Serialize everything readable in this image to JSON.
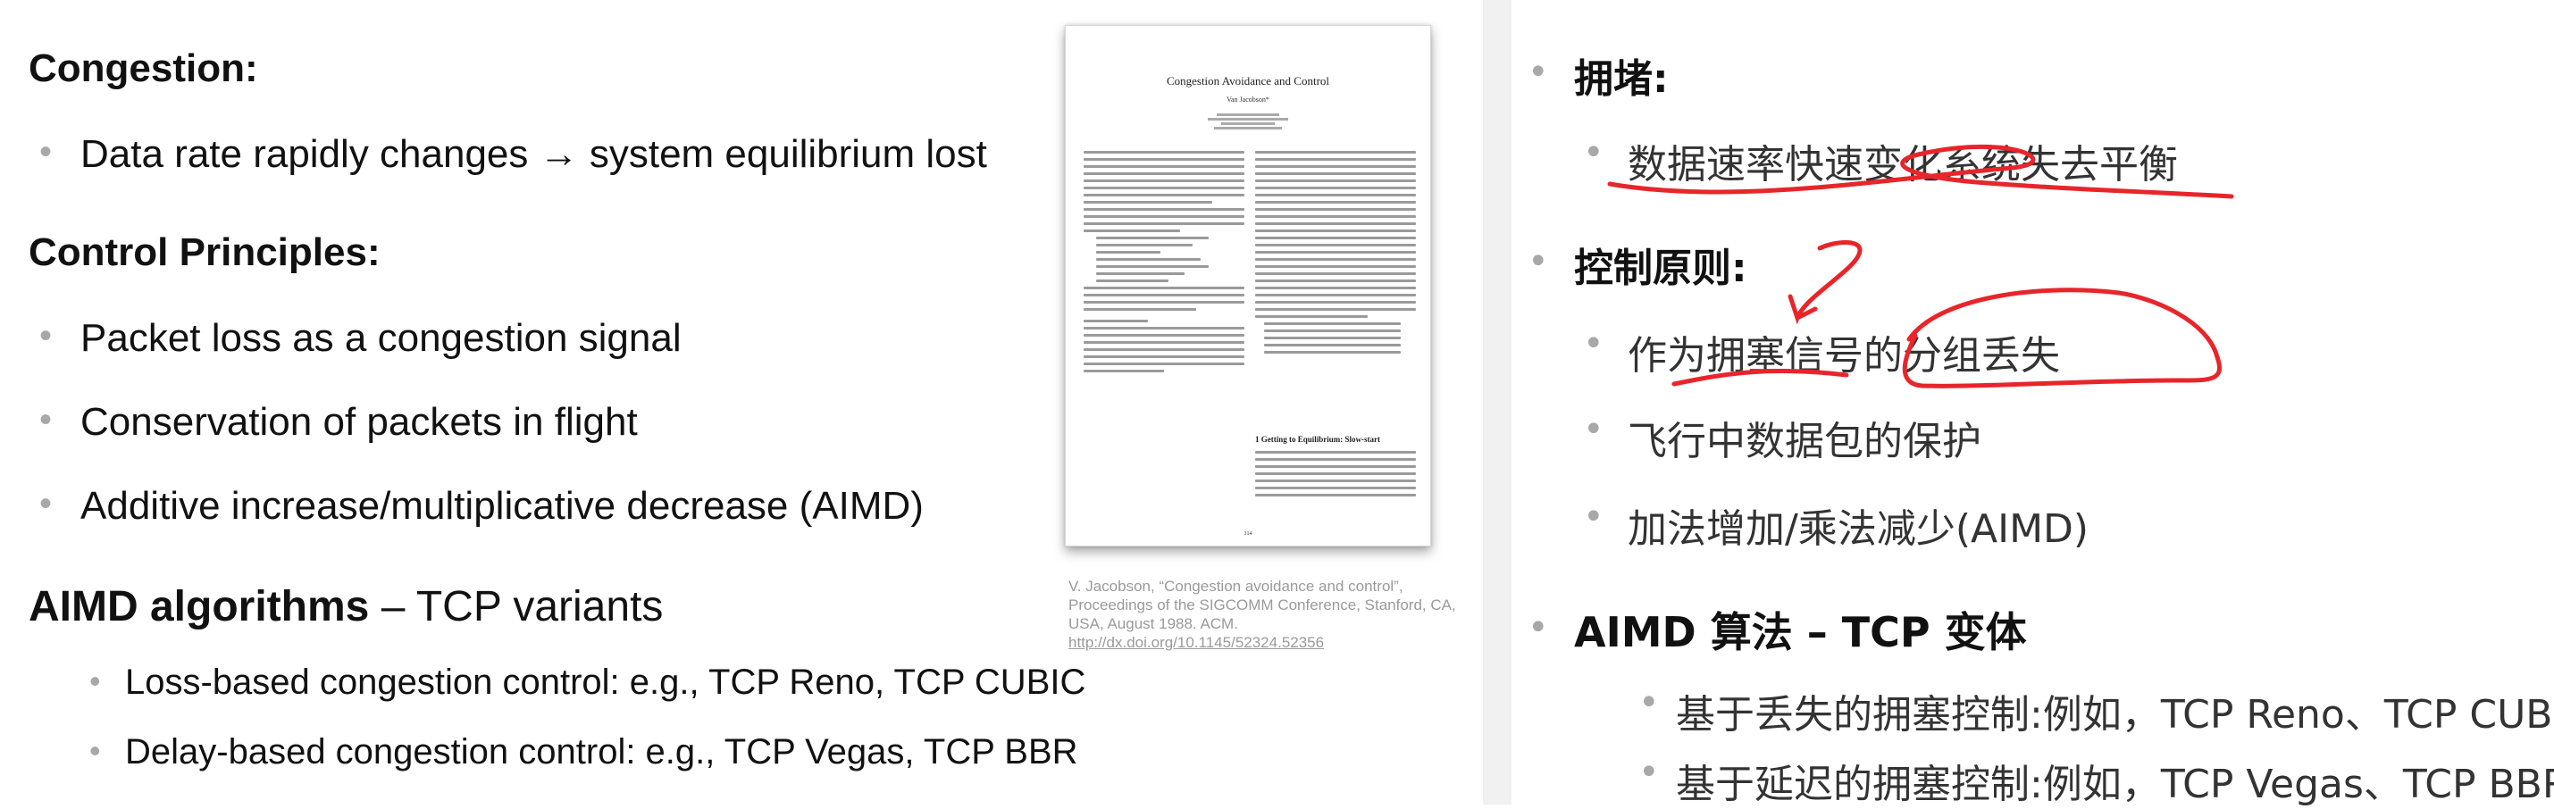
{
  "left": {
    "congestion_heading": "Congestion:",
    "congestion_point": "Data rate rapidly changes → system equilibrium lost",
    "principles_heading": "Control Principles:",
    "principles": [
      "Packet loss as a congestion signal",
      "Conservation of packets in flight",
      "Additive increase/multiplicative decrease (AIMD)"
    ],
    "aimd_heading_bold": "AIMD algorithms",
    "aimd_heading_rest": " – TCP variants",
    "aimd_items": [
      "Loss-based congestion control: e.g., TCP Reno, TCP CUBIC",
      "Delay-based congestion control: e.g., TCP Vegas, TCP BBR"
    ]
  },
  "paper": {
    "title": "Congestion Avoidance and Control",
    "author": "Van Jacobson*",
    "section_heading": "1   Getting to Equilibrium: Slow-start"
  },
  "citation": {
    "text": "V. Jacobson, “Congestion avoidance and control”, Proceedings of the SIGCOMM Conference, Stanford, CA, USA, August 1988. ACM. ",
    "link": "http://dx.doi.org/10.1145/52324.52356"
  },
  "right": {
    "congestion_heading": "拥堵:",
    "congestion_point": "数据速率快速变化系统失去平衡",
    "principles_heading": "控制原则:",
    "principles": [
      "作为拥塞信号的分组丢失",
      "飞行中数据包的保护",
      "加法增加/乘法减少(AIMD)"
    ],
    "aimd_heading": "AIMD 算法 – TCP 变体",
    "aimd_items": [
      "基于丢失的拥塞控制:例如，TCP Reno、TCP CUBIC",
      "基于延迟的拥塞控制:例如，TCP Vegas、TCP BBR"
    ]
  },
  "colors": {
    "ink": "#e8252a",
    "bullet": "#a8a8a8",
    "citation": "#9a9a9a"
  }
}
